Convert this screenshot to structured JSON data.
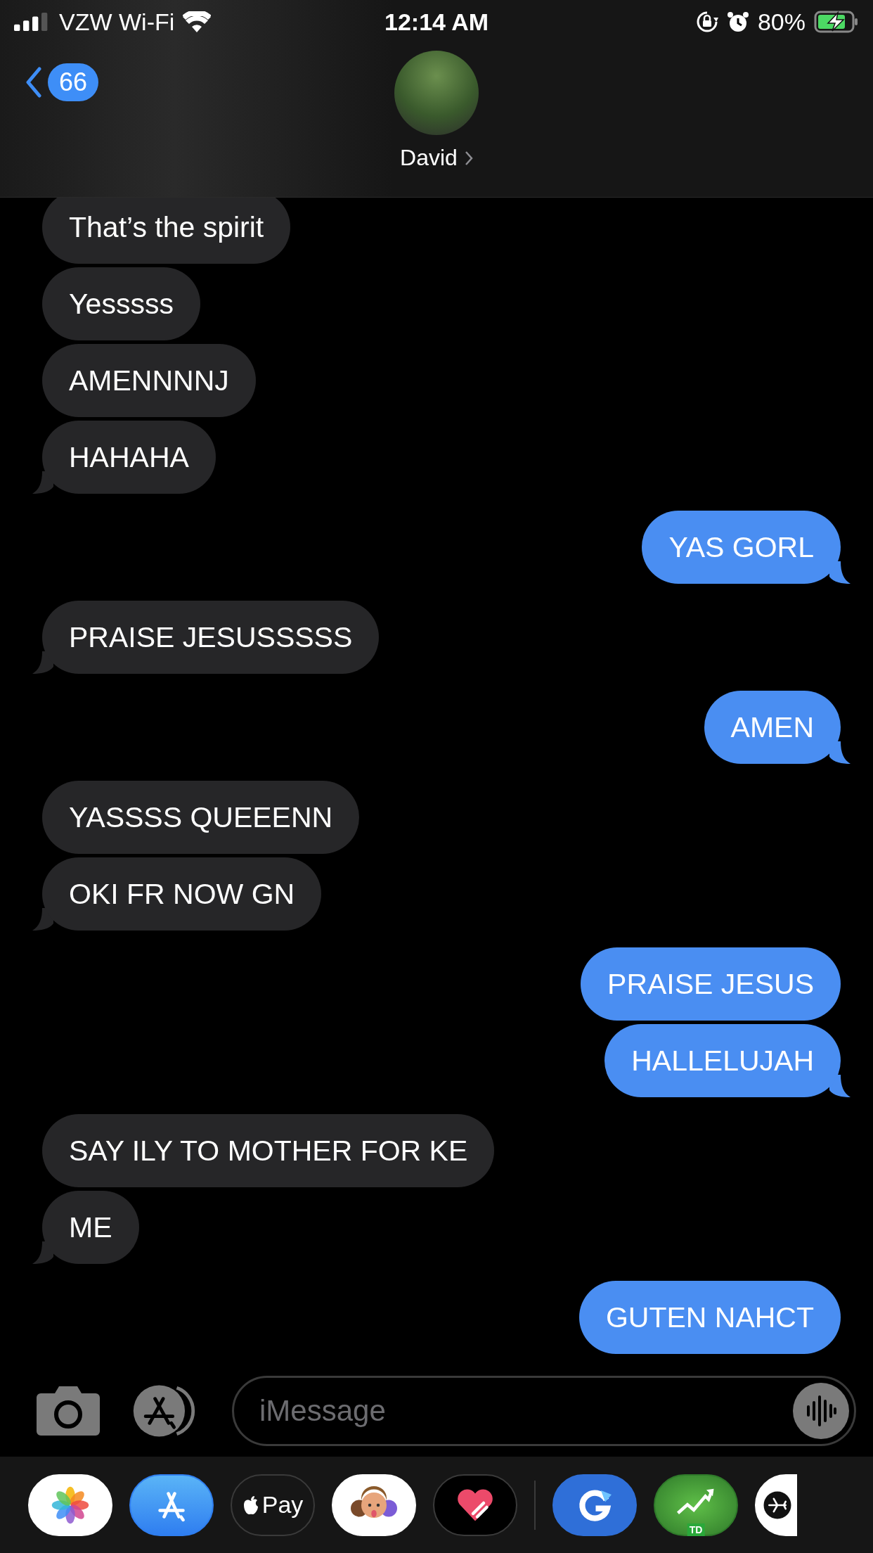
{
  "status_bar": {
    "carrier": "VZW Wi-Fi",
    "time": "12:14 AM",
    "battery": "80%"
  },
  "nav": {
    "back_badge": "66",
    "contact": "David"
  },
  "messages": [
    {
      "text": "That’s the spirit",
      "sent": false,
      "tail": false
    },
    {
      "text": "Yesssss",
      "sent": false,
      "tail": false
    },
    {
      "text": "AMENNNNJ",
      "sent": false,
      "tail": false
    },
    {
      "text": "HAHAHA",
      "sent": false,
      "tail": true
    },
    {
      "text": "YAS GORL",
      "sent": true,
      "tail": true
    },
    {
      "text": "PRAISE JESUSSSSS",
      "sent": false,
      "tail": true
    },
    {
      "text": "AMEN",
      "sent": true,
      "tail": true
    },
    {
      "text": "YASSSS QUEEENN",
      "sent": false,
      "tail": false
    },
    {
      "text": "OKI FR NOW GN",
      "sent": false,
      "tail": true
    },
    {
      "text": "PRAISE JESUS",
      "sent": true,
      "tail": false
    },
    {
      "text": "HALLELUJAH",
      "sent": true,
      "tail": true
    },
    {
      "text": "SAY ILY TO MOTHER FOR KE",
      "sent": false,
      "tail": false
    },
    {
      "text": "ME",
      "sent": false,
      "tail": true
    },
    {
      "text": "GUTEN NAHCT",
      "sent": true,
      "tail": false
    }
  ],
  "composer": {
    "placeholder": "iMessage"
  },
  "app_strip": [
    {
      "kind": "photos"
    },
    {
      "kind": "appstore"
    },
    {
      "kind": "applepay",
      "label": "Pay"
    },
    {
      "kind": "memoji"
    },
    {
      "kind": "heart"
    },
    {
      "kind": "divider"
    },
    {
      "kind": "refresh"
    },
    {
      "kind": "stocks",
      "label": "TD"
    },
    {
      "kind": "airplane"
    }
  ]
}
